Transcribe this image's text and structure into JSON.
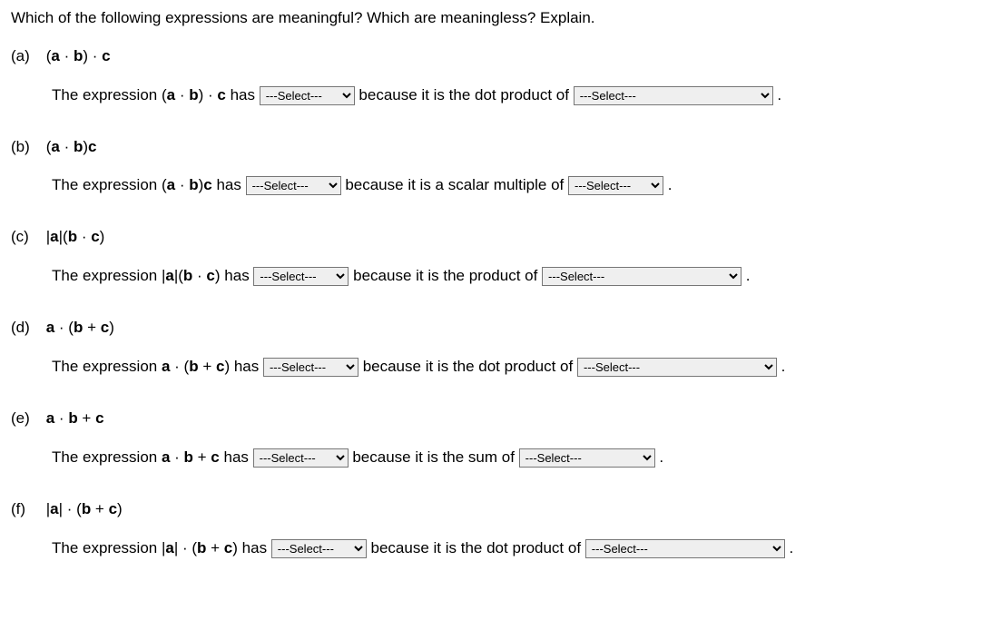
{
  "prompt": "Which of the following expressions are meaningful? Which are meaningless? Explain.",
  "select_placeholder": "---Select---",
  "parts": {
    "a": {
      "label": "(a)",
      "expr_html": "(<b class='v'>a</b> · <b class='v'>b</b>) · <b class='v'>c</b>",
      "pre": "The expression (",
      "mid_expr": " · ",
      "post_expr": ") · ",
      "has_text": " has ",
      "reason": " because it is the dot product of "
    },
    "b": {
      "label": "(b)",
      "expr_html": "(<b class='v'>a</b> · <b class='v'>b</b>)<b class='v'>c</b>",
      "has_text": " has ",
      "reason": " because it is a scalar multiple of "
    },
    "c": {
      "label": "(c)",
      "expr_html": "|<b class='v'>a</b>|(<b class='v'>b</b> · <b class='v'>c</b>)",
      "has_text": " has ",
      "reason": " because it is the product of "
    },
    "d": {
      "label": "(d)",
      "expr_html": "<b class='v'>a</b> · (<b class='v'>b</b> + <b class='v'>c</b>)",
      "has_text": " has ",
      "reason": " because it is the dot product of "
    },
    "e": {
      "label": "(e)",
      "expr_html": "<b class='v'>a</b> · <b class='v'>b</b> + <b class='v'>c</b>",
      "has_text": " has ",
      "reason": " because it is the sum of "
    },
    "f": {
      "label": "(f)",
      "expr_html": "|<b class='v'>a</b>| · (<b class='v'>b</b> + <b class='v'>c</b>)",
      "has_text": " has ",
      "reason": " because it is the dot product of "
    }
  },
  "period": " ."
}
